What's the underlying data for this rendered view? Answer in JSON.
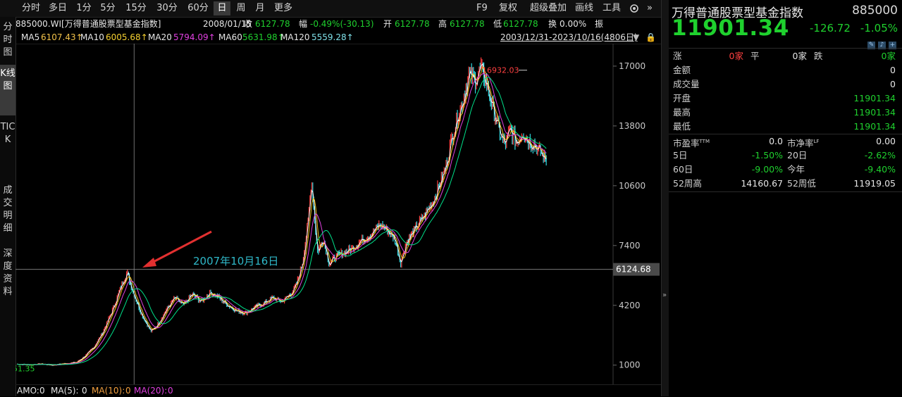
{
  "toolbar": {
    "periods": [
      "分时",
      "多日",
      "1分",
      "5分",
      "15分",
      "30分",
      "60分",
      "日",
      "周",
      "月",
      "更多"
    ],
    "selected": "日",
    "right": [
      "F9",
      "复权",
      "超级叠加",
      "画线",
      "工具"
    ]
  },
  "info": {
    "security": "885000.WI[万得普通股票型基金指数]",
    "date": "2008/01/15",
    "close_label": "收",
    "close": "6127.78",
    "change_label": "幅",
    "change": "-0.49%(-30.13)",
    "open_label": "开",
    "open": "6127.78",
    "high_label": "高",
    "high": "6127.78",
    "low_label": "低",
    "low": "6127.78",
    "turnover_label": "换",
    "turnover": "0.00%",
    "amp_label": "振"
  },
  "ma": {
    "ma5_label": "MA5",
    "ma5": "6107.43↑",
    "ma10_label": "MA10",
    "ma10": "6005.68↑",
    "ma20_label": "MA20",
    "ma20": "5794.09↑",
    "ma60_label": "MA60",
    "ma60": "5631.98↑",
    "ma120_label": "MA120",
    "ma120": "5559.28↑",
    "range": "2003/12/31-2023/10/16(4806日)"
  },
  "vtabs": [
    "分时图",
    "K线图",
    "TICK",
    "成交明细",
    "深度资料"
  ],
  "vtab_selected": "K线图",
  "chart_data": {
    "type": "line",
    "y_axis_ticks": [
      "17000",
      "13800",
      "10600",
      "7400",
      "4200",
      "1000"
    ],
    "y_min": 500,
    "y_max": 17600,
    "crosshair_value": "6124.68",
    "max_label": "16932.03",
    "min_label": "51.35",
    "annotation": "2007年10月16日",
    "colors": {
      "up": "#ff3b3b",
      "down": "#2fd7e0",
      "ma5": "#ffffff",
      "ma10": "#f5c518",
      "ma20": "#e040e0",
      "ma60": "#00e08a",
      "accent": "#2fb8c8"
    },
    "series_points": [
      [
        0.0,
        1050
      ],
      [
        0.02,
        1020
      ],
      [
        0.04,
        1060
      ],
      [
        0.06,
        1000
      ],
      [
        0.08,
        1080
      ],
      [
        0.1,
        1150
      ],
      [
        0.115,
        1500
      ],
      [
        0.13,
        2000
      ],
      [
        0.145,
        2800
      ],
      [
        0.16,
        3900
      ],
      [
        0.175,
        5200
      ],
      [
        0.185,
        6000
      ],
      [
        0.19,
        5400
      ],
      [
        0.2,
        4500
      ],
      [
        0.21,
        3700
      ],
      [
        0.225,
        2800
      ],
      [
        0.235,
        3100
      ],
      [
        0.25,
        3900
      ],
      [
        0.265,
        4600
      ],
      [
        0.28,
        4200
      ],
      [
        0.295,
        4800
      ],
      [
        0.31,
        4400
      ],
      [
        0.325,
        4900
      ],
      [
        0.34,
        4600
      ],
      [
        0.355,
        4200
      ],
      [
        0.37,
        3900
      ],
      [
        0.385,
        3800
      ],
      [
        0.4,
        4100
      ],
      [
        0.415,
        4300
      ],
      [
        0.43,
        4600
      ],
      [
        0.445,
        4400
      ],
      [
        0.46,
        4800
      ],
      [
        0.47,
        5300
      ],
      [
        0.48,
        6500
      ],
      [
        0.49,
        8800
      ],
      [
        0.495,
        11000
      ],
      [
        0.5,
        9000
      ],
      [
        0.505,
        7000
      ],
      [
        0.515,
        7800
      ],
      [
        0.525,
        6400
      ],
      [
        0.535,
        6800
      ],
      [
        0.55,
        7000
      ],
      [
        0.565,
        7300
      ],
      [
        0.58,
        7700
      ],
      [
        0.595,
        8000
      ],
      [
        0.61,
        8500
      ],
      [
        0.62,
        8300
      ],
      [
        0.635,
        7800
      ],
      [
        0.645,
        6500
      ],
      [
        0.655,
        7600
      ],
      [
        0.67,
        8300
      ],
      [
        0.685,
        9000
      ],
      [
        0.7,
        9800
      ],
      [
        0.71,
        10600
      ],
      [
        0.72,
        11500
      ],
      [
        0.73,
        13000
      ],
      [
        0.74,
        14200
      ],
      [
        0.75,
        15200
      ],
      [
        0.76,
        16500
      ],
      [
        0.77,
        16200
      ],
      [
        0.78,
        16900
      ],
      [
        0.79,
        16000
      ],
      [
        0.8,
        14800
      ],
      [
        0.81,
        13600
      ],
      [
        0.82,
        12800
      ],
      [
        0.83,
        13600
      ],
      [
        0.84,
        12900
      ],
      [
        0.85,
        13500
      ],
      [
        0.86,
        13000
      ],
      [
        0.87,
        12800
      ],
      [
        0.88,
        12400
      ],
      [
        0.89,
        11900
      ]
    ]
  },
  "bottom": {
    "amo_label": "AMO:",
    "amo": "0",
    "ma5_label": "MA(5):",
    "ma5": "0",
    "ma10_label": "MA(10):",
    "ma10": "0",
    "ma20_label": "MA(20):",
    "ma20": "0"
  },
  "quote": {
    "name": "万得普通股票型基金指数",
    "code": "885000",
    "price": "11901.34",
    "change": "-126.72",
    "pct": "-1.05%",
    "breadth": {
      "up_label": "涨",
      "up": "0家",
      "flat_label": "平",
      "flat": "0家",
      "down_label": "跌",
      "down": "0家"
    },
    "stats": [
      {
        "label": "金额",
        "value": "0"
      },
      {
        "label": "成交量",
        "value": "0"
      },
      {
        "label": "开盘",
        "value": "11901.34"
      },
      {
        "label": "最高",
        "value": "11901.34"
      },
      {
        "label": "最低",
        "value": "11901.34"
      }
    ],
    "pe_label": "市盈率",
    "pe_sup": "TTM",
    "pe": "0.0",
    "pb_label": "市净率",
    "pb_sup": "LF",
    "pb": "0.00",
    "d5_label": "5日",
    "d5": "-1.50%",
    "d20_label": "20日",
    "d20": "-2.62%",
    "d60_label": "60日",
    "d60": "-9.00%",
    "ytd_label": "今年",
    "ytd": "-9.40%",
    "w52h_label": "52周高",
    "w52h": "14160.67",
    "w52l_label": "52周低",
    "w52l": "11919.05"
  }
}
